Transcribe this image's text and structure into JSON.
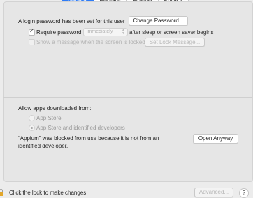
{
  "tabs": [
    {
      "label": "General",
      "active": true
    },
    {
      "label": "FileVault",
      "active": false
    },
    {
      "label": "Firewall",
      "active": false
    },
    {
      "label": "Privacy",
      "active": false
    }
  ],
  "login": {
    "password_text": "A login password has been set for this user",
    "change_password_label": "Change Password..."
  },
  "require_password": {
    "label": "Require password",
    "checked": true,
    "select_value": "immediately",
    "after_text": "after sleep or screen saver begins"
  },
  "show_message": {
    "label": "Show a message when the screen is locked",
    "checked": false,
    "button_label": "Set Lock Message..."
  },
  "allow_apps": {
    "heading": "Allow apps downloaded from:",
    "options": [
      {
        "label": "App Store",
        "selected": false
      },
      {
        "label": "App Store and identified developers",
        "selected": true
      }
    ]
  },
  "blocked": {
    "line1": "“Appium” was blocked from use because it is not from an",
    "line2": "identified developer.",
    "open_anyway_label": "Open Anyway"
  },
  "footer": {
    "lock_text": "Click the lock to make changes.",
    "advanced_label": "Advanced...",
    "help_label": "?"
  },
  "colors": {
    "accent": "#2f7cf6",
    "lock": "#e2a72a"
  }
}
